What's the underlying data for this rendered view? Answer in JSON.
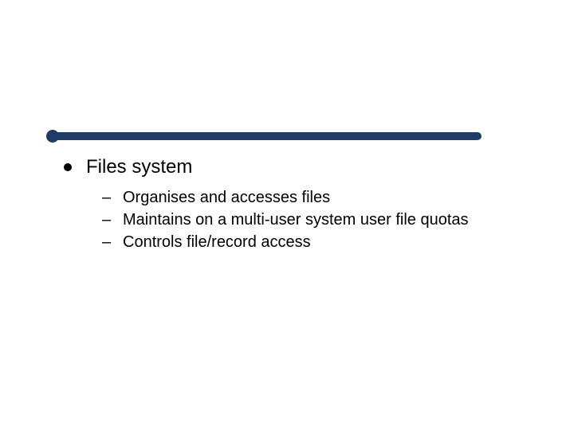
{
  "slide": {
    "heading": "Files system",
    "sub_bullets": [
      "Organises and accesses files",
      "Maintains on a multi-user system user file quotas",
      "Controls file/record access"
    ],
    "dash_glyph": "–"
  }
}
